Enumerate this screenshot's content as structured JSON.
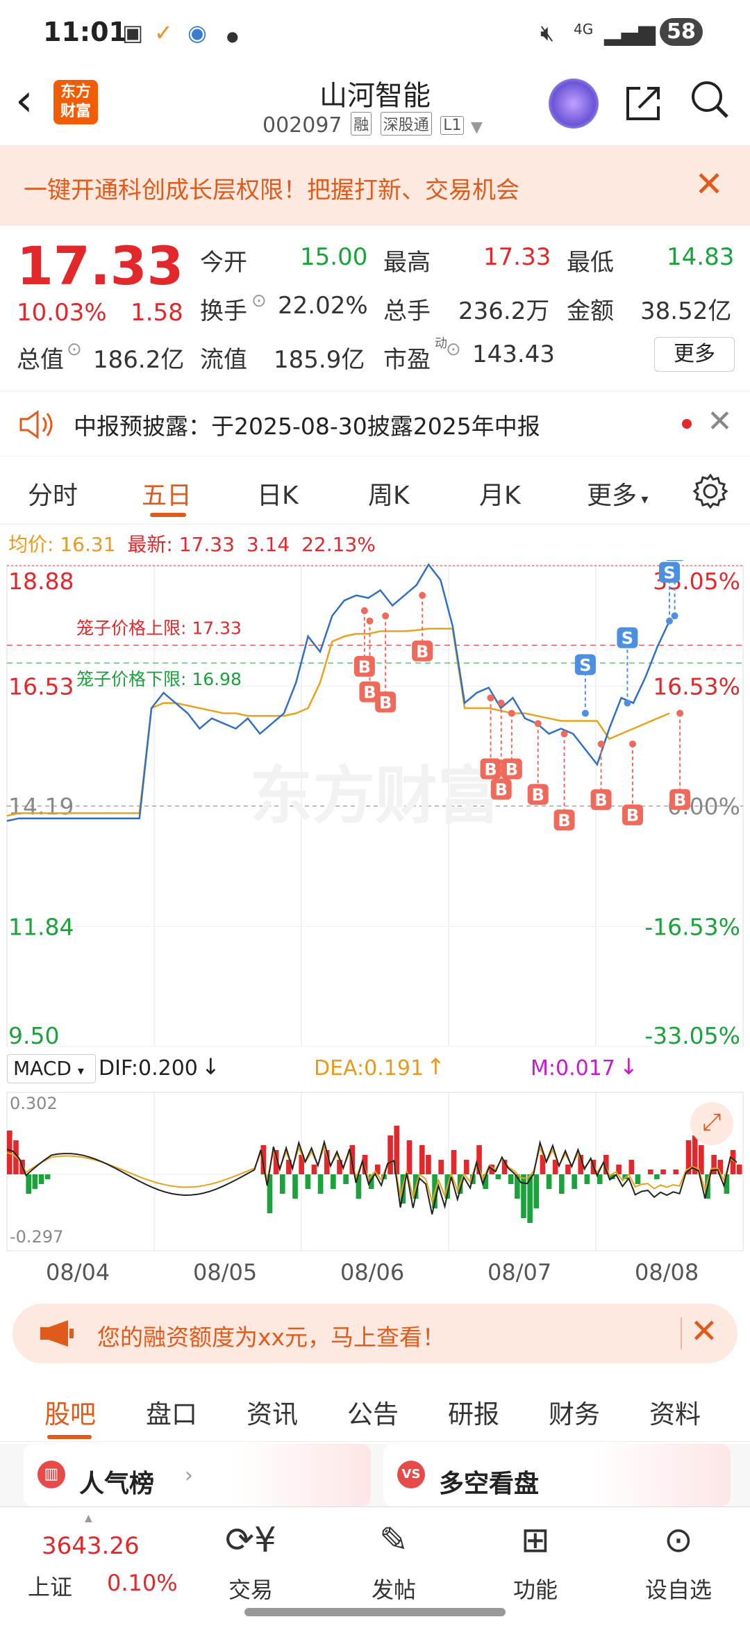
{
  "status_bar": {
    "time": "11:01",
    "network": "4G",
    "battery": "58"
  },
  "header": {
    "logo_line1": "东方",
    "logo_line2": "财富",
    "stock_name": "山河智能",
    "stock_code": "002097",
    "tags": [
      "融",
      "深股通",
      "L1"
    ]
  },
  "promo": {
    "text": "一键开通科创成长层权限！把握打新、交易机会"
  },
  "quote": {
    "price": "17.33",
    "change_pct": "10.03%",
    "change": "1.58",
    "open_label": "今开",
    "open": "15.00",
    "high_label": "最高",
    "high": "17.33",
    "low_label": "最低",
    "low": "14.83",
    "turnover_label": "换手",
    "turnover": "22.02%",
    "volume_label": "总手",
    "volume": "236.2万",
    "amount_label": "金额",
    "amount": "38.52亿",
    "mktcap_label": "总值",
    "mktcap": "186.2亿",
    "float_label": "流值",
    "float": "185.9亿",
    "pe_label": "市盈",
    "pe_sup": "动",
    "pe": "143.43",
    "more": "更多"
  },
  "notice": {
    "text": "中报预披露：于2025-08-30披露2025年中报"
  },
  "tabs": [
    "分时",
    "五日",
    "日K",
    "周K",
    "月K",
    "更多"
  ],
  "chart_header": {
    "avg_label": "均价:",
    "avg": "16.31",
    "last_label": "最新:",
    "last": "17.33",
    "chg": "3.14",
    "pct": "22.13%"
  },
  "chart_data": {
    "type": "line",
    "x": [
      "08/04",
      "08/05",
      "08/06",
      "08/07",
      "08/08"
    ],
    "y_left_ticks": [
      "18.88",
      "16.53",
      "14.19",
      "11.84",
      "9.50"
    ],
    "y_right_ticks": [
      "33.05%",
      "16.53%",
      "0.00%",
      "-16.53%",
      "-33.05%"
    ],
    "ylim": [
      9.5,
      18.88
    ],
    "base_price": 14.19,
    "cage_upper_label": "笼子价格上限: 17.33",
    "cage_lower_label": "笼子价格下限: 16.98",
    "cage_upper": 17.33,
    "cage_lower": 16.98,
    "watermark": "东方财富",
    "series": [
      {
        "name": "价格",
        "color": "#2f6fc4",
        "values": [
          13.9,
          13.95,
          13.95,
          13.95,
          13.95,
          13.95,
          13.95,
          13.95,
          13.95,
          13.95,
          13.95,
          13.95,
          16.1,
          16.4,
          16.2,
          16.0,
          15.7,
          15.9,
          15.8,
          15.7,
          15.9,
          15.6,
          15.8,
          16.0,
          16.6,
          17.5,
          17.2,
          17.9,
          18.2,
          18.3,
          18.25,
          18.4,
          18.1,
          18.3,
          18.5,
          18.9,
          18.6,
          17.7,
          16.2,
          16.4,
          16.5,
          16.1,
          16.3,
          15.9,
          15.8,
          15.6,
          15.7,
          15.6,
          15.3,
          15.0,
          15.7,
          16.3,
          16.2,
          16.7,
          17.3,
          17.8
        ]
      },
      {
        "name": "均价",
        "color": "#e8a31c",
        "values": [
          14.0,
          14.05,
          14.05,
          14.05,
          14.05,
          14.05,
          14.05,
          14.05,
          14.05,
          14.05,
          14.05,
          14.05,
          16.1,
          16.2,
          16.2,
          16.15,
          16.1,
          16.05,
          16.0,
          16.0,
          15.95,
          15.95,
          15.95,
          15.95,
          16.0,
          16.1,
          16.6,
          17.4,
          17.5,
          17.55,
          17.55,
          17.6,
          17.6,
          17.6,
          17.62,
          17.65,
          17.65,
          17.65,
          16.1,
          16.1,
          16.1,
          16.05,
          16.0,
          16.0,
          15.95,
          15.9,
          15.85,
          15.85,
          15.85,
          15.85,
          15.5,
          15.6,
          15.7,
          15.8,
          15.9,
          16.0
        ]
      }
    ],
    "buy_markers": [
      [
        6.8,
        18.0
      ],
      [
        6.9,
        17.8
      ],
      [
        7.2,
        17.9
      ],
      [
        7.9,
        18.3
      ],
      [
        9.2,
        16.3
      ],
      [
        9.4,
        16.2
      ],
      [
        9.6,
        16.0
      ],
      [
        10.1,
        15.8
      ],
      [
        10.6,
        15.6
      ],
      [
        11.3,
        15.4
      ],
      [
        11.9,
        15.4
      ],
      [
        12.8,
        16.0
      ]
    ],
    "sell_markers": [
      [
        11.0,
        16.0
      ],
      [
        11.8,
        16.2
      ],
      [
        12.6,
        17.8
      ],
      [
        12.7,
        17.9
      ]
    ],
    "macd": {
      "label": "MACD",
      "dif_label": "DIF:0.200",
      "dea_label": "DEA:0.191",
      "m_label": "M:0.017",
      "max_label": "0.302",
      "min_label": "-0.297"
    }
  },
  "margin_banner": {
    "text": "您的融资额度为xx元，马上查看！"
  },
  "bottom_tabs": [
    "股吧",
    "盘口",
    "资讯",
    "公告",
    "研报",
    "财务",
    "资料"
  ],
  "cards": [
    "人气榜",
    "多空看盘"
  ],
  "bottom_nav": {
    "index_value": "3643.26",
    "index_name": "上证",
    "index_pct": "0.10%",
    "items": [
      "交易",
      "发帖",
      "功能",
      "设自选"
    ]
  }
}
